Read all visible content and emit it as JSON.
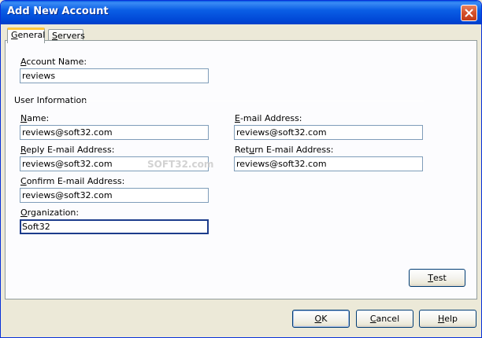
{
  "window": {
    "title": "Add New Account",
    "close_icon": "close-icon",
    "accent_color": "#0a5ee5"
  },
  "tabs": [
    {
      "label": "General",
      "mnemonic": "G",
      "rest": "eneral"
    },
    {
      "label": "Servers",
      "mnemonic": "S",
      "rest": "ervers"
    }
  ],
  "general": {
    "account_name": {
      "label": "Account Name:",
      "mn": "A",
      "rest": "ccount Name:",
      "value": "reviews"
    },
    "group_label": "User Information",
    "name": {
      "label": "Name:",
      "mn": "N",
      "rest": "ame:",
      "value": "reviews@soft32.com"
    },
    "email": {
      "label": "E-mail Address:",
      "mn": "E",
      "rest": "-mail Address:",
      "value": "reviews@soft32.com"
    },
    "reply_email": {
      "label": "Reply E-mail Address:",
      "mn": "R",
      "rest": "eply E-mail Address:",
      "value": "reviews@soft32.com"
    },
    "return_email": {
      "label": "Return E-mail Address:",
      "pre": "Ret",
      "mn": "u",
      "rest": "rn E-mail Address:",
      "value": "reviews@soft32.com"
    },
    "confirm_email": {
      "label": "Confirm E-mail Address:",
      "mn": "C",
      "rest": "onfirm E-mail Address:",
      "value": "reviews@soft32.com"
    },
    "organization": {
      "label": "Organization:",
      "mn": "O",
      "rest": "rganization:",
      "value": "Soft32"
    },
    "test_button": {
      "label": "Test",
      "mn": "T",
      "rest": "est"
    }
  },
  "footer": {
    "ok": {
      "label": "OK",
      "mn": "O",
      "rest": "K"
    },
    "cancel": {
      "label": "Cancel",
      "mn": "C",
      "rest": "ancel"
    },
    "help": {
      "label": "Help",
      "mn": "H",
      "rest": "elp"
    }
  },
  "watermark": "SOFT32.com"
}
